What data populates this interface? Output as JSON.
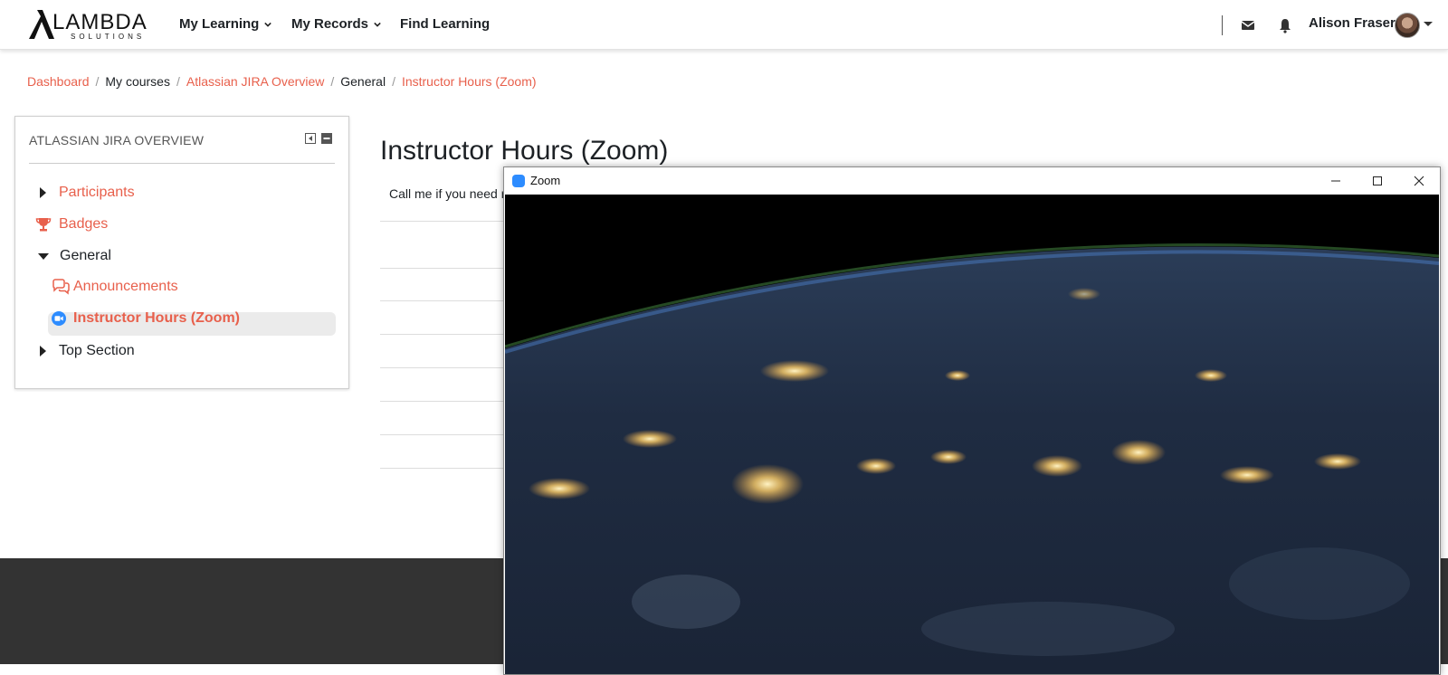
{
  "brand": {
    "name": "LAMBDA",
    "tagline": "SOLUTIONS",
    "accent": "#e8604c",
    "footer_color": "#333333"
  },
  "nav": {
    "items": [
      {
        "label": "My Learning",
        "has_dropdown": true
      },
      {
        "label": "My Records",
        "has_dropdown": true
      },
      {
        "label": "Find Learning",
        "has_dropdown": false
      }
    ],
    "icons": [
      "envelope-icon",
      "bell-icon"
    ],
    "user": {
      "name": "Alison Fraser"
    }
  },
  "breadcrumb": [
    {
      "label": "Dashboard",
      "link": true
    },
    {
      "label": "My courses",
      "link": false
    },
    {
      "label": "Atlassian JIRA Overview",
      "link": true
    },
    {
      "label": "General",
      "link": false
    },
    {
      "label": "Instructor Hours (Zoom)",
      "link": true
    }
  ],
  "sidebar": {
    "title": "ATLASSIAN JIRA OVERVIEW",
    "items": [
      {
        "label": "Participants",
        "icon": "triangle-right-icon",
        "link": true
      },
      {
        "label": "Badges",
        "icon": "trophy-icon",
        "link": true
      },
      {
        "label": "General",
        "icon": "triangle-down-icon",
        "link": false
      },
      {
        "label": "Announcements",
        "icon": "forum-icon",
        "link": true
      },
      {
        "label": "Instructor Hours (Zoom)",
        "icon": "zoom-icon",
        "link": true,
        "active": true
      },
      {
        "label": "Top Section",
        "icon": "triangle-right-icon",
        "link": false
      }
    ]
  },
  "main": {
    "title": "Instructor Hours (Zoom)",
    "intro": "Call me if you need r"
  },
  "zoom_window": {
    "title": "Zoom",
    "brand_color": "#2d8cff"
  }
}
